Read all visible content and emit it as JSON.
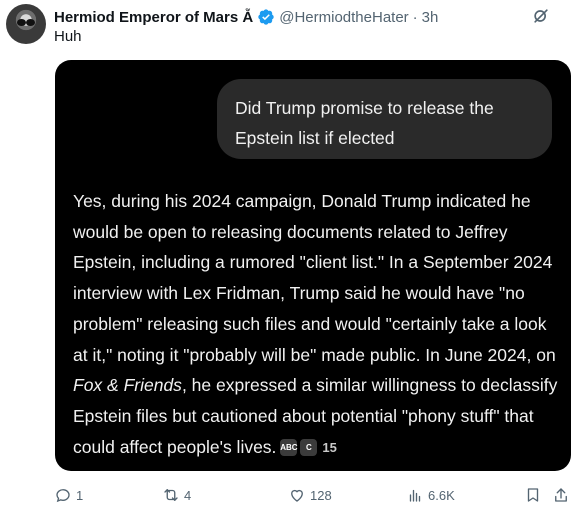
{
  "tweet": {
    "author_name": "Hermiod Emperor of Mars Ẵ",
    "handle": "@HermiodtheHater",
    "dot": "·",
    "time": "3h",
    "text": "Huh"
  },
  "media": {
    "question": "Did Trump promise to release the Epstein list if elected",
    "answer_before_italic": "Yes, during his 2024 campaign, Donald Trump indicated he would be open to releasing documents related to Jeffrey Epstein, including a rumored \"client list.\" In a September 2024 interview with Lex Fridman, Trump said he would have \"no problem\" releasing such files and would \"certainly take a look at it,\" noting it \"probably will be\" made public. In June 2024, on ",
    "answer_italic": "Fox & Friends",
    "answer_after_italic": ", he expressed a similar willingness to declassify Epstein files but cautioned about potential \"phony stuff\" that could affect people's lives.",
    "source_count": "15",
    "source_icon_1": "ABC",
    "source_icon_2": "C"
  },
  "actions": {
    "replies": "1",
    "reposts": "4",
    "likes": "128",
    "views": "6.6K"
  },
  "colors": {
    "verified_blue": "#1d9bf0",
    "secondary_text": "#536471",
    "media_bg": "#000000",
    "bubble_bg": "#2a2a2a"
  },
  "icons": [
    "verified-badge-icon",
    "grok-icon",
    "reply-icon",
    "repost-icon",
    "like-icon",
    "views-icon",
    "bookmark-icon",
    "share-icon"
  ]
}
